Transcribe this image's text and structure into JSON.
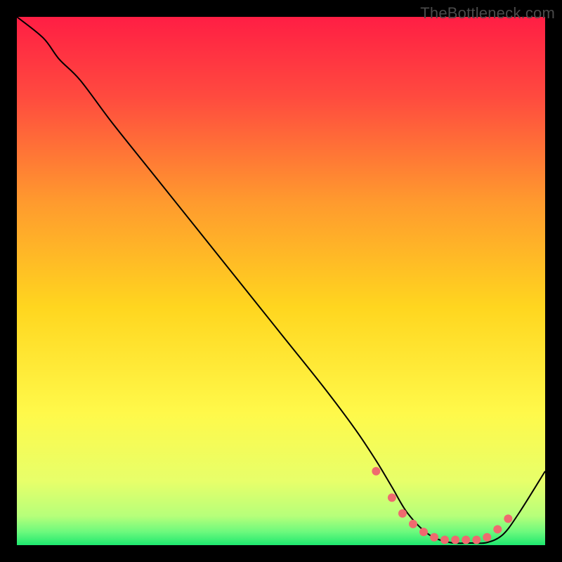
{
  "watermark": "TheBottleneck.com",
  "chart_data": {
    "type": "line",
    "title": "",
    "xlabel": "",
    "ylabel": "",
    "xlim": [
      0,
      100
    ],
    "ylim": [
      0,
      100
    ],
    "background_gradient": {
      "stops": [
        {
          "pos": 0.0,
          "color": "#ff1e44"
        },
        {
          "pos": 0.15,
          "color": "#ff4a3f"
        },
        {
          "pos": 0.35,
          "color": "#ff9a2e"
        },
        {
          "pos": 0.55,
          "color": "#ffd61f"
        },
        {
          "pos": 0.75,
          "color": "#fff94a"
        },
        {
          "pos": 0.88,
          "color": "#e7ff6a"
        },
        {
          "pos": 0.945,
          "color": "#b6ff7a"
        },
        {
          "pos": 0.975,
          "color": "#6cf97d"
        },
        {
          "pos": 1.0,
          "color": "#1ee86f"
        }
      ]
    },
    "series": [
      {
        "name": "bottleneck-curve",
        "color": "#000000",
        "width": 2,
        "x": [
          0,
          5,
          8,
          12,
          18,
          26,
          34,
          42,
          50,
          58,
          64,
          68,
          71,
          74,
          78,
          82,
          86,
          89,
          92,
          95,
          100
        ],
        "y": [
          100,
          96,
          92,
          88,
          80,
          70,
          60,
          50,
          40,
          30,
          22,
          16,
          11,
          6,
          2,
          0.5,
          0.4,
          0.5,
          2,
          6,
          14
        ]
      }
    ],
    "markers": {
      "name": "highlight-dots",
      "color": "#ef6a6f",
      "radius": 6,
      "x": [
        68,
        71,
        73,
        75,
        77,
        79,
        81,
        83,
        85,
        87,
        89,
        91,
        93
      ],
      "y": [
        14,
        9,
        6,
        4,
        2.5,
        1.5,
        1,
        1,
        1,
        1,
        1.5,
        3,
        5
      ]
    }
  }
}
